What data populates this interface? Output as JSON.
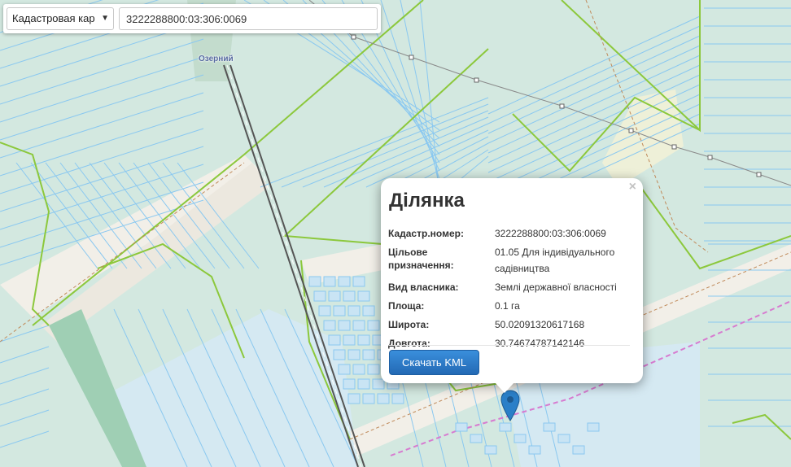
{
  "map": {
    "place_label": "Озерний",
    "colors": {
      "background": "#d3e8e0",
      "parcel_line": "#8ac8f0",
      "boundary_green": "#8cc83c",
      "road": "#f2efe8",
      "railway": "#555555",
      "marker": "#2a7fc8"
    }
  },
  "toolbar": {
    "layer_select": {
      "value": "Кадастровая кар",
      "caret": "▼"
    },
    "search": {
      "value": "3222288800:03:306:0069"
    }
  },
  "popup": {
    "close": "×",
    "title": "Ділянка",
    "fields": [
      {
        "key": "Кадастр.номер:",
        "value": "3222288800:03:306:0069"
      },
      {
        "key": "Цільове призначення:",
        "value": "01.05 Для індивідуального садівництва"
      },
      {
        "key": "Вид власника:",
        "value": "Землі державної власності"
      },
      {
        "key": "Площа:",
        "value": "0.1 га"
      },
      {
        "key": "Широта:",
        "value": "50.02091320617168"
      },
      {
        "key": "Довгота:",
        "value": "30.74674787142146"
      }
    ],
    "download_button": "Скачать KML"
  }
}
